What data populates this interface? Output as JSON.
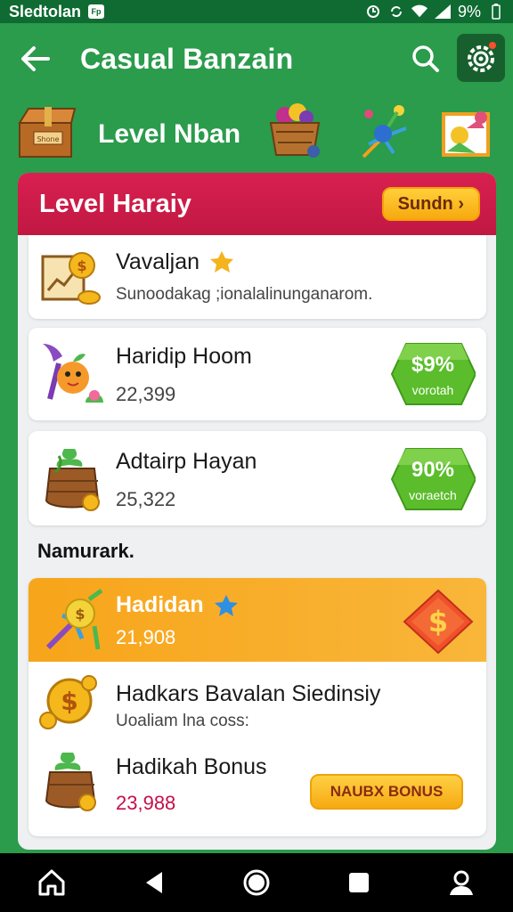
{
  "status_bar": {
    "carrier": "Sledtolan",
    "notification_badge": "Fp",
    "battery_text": "9%"
  },
  "app_bar": {
    "title": "Casual Banzain"
  },
  "level_row": {
    "title": "Level Nban"
  },
  "card": {
    "header_title": "Level Haraiy",
    "header_button": "Sundn ›"
  },
  "items": [
    {
      "title": "Vavaljan",
      "subtitle": "Sunoodakag ;ionalalinunganarom.",
      "star": true
    },
    {
      "title": "Haridip Hoom",
      "value": "22,399",
      "badge_pct": "$9%",
      "badge_label": "vorotah"
    },
    {
      "title": "Adtairp Hayan",
      "value": "25,322",
      "badge_pct": "90%",
      "badge_label": "voraetch"
    }
  ],
  "section_label": "Namurark.",
  "featured": {
    "title": "Hadidan",
    "value": "21,908",
    "sub_items": [
      {
        "title": "Hadkars Bavalan Siedinsiy",
        "subtitle": "Uoaliam lna coss:"
      },
      {
        "title": "Hadikah Bonus",
        "value": "23,988",
        "button": "NAUBX BONUS"
      }
    ]
  },
  "colors": {
    "background": "#2b9b4c",
    "header_red": "#d92050",
    "accent_orange": "#f7a51a",
    "badge_green": "#5bbd2b",
    "value_red": "#c4104a"
  }
}
